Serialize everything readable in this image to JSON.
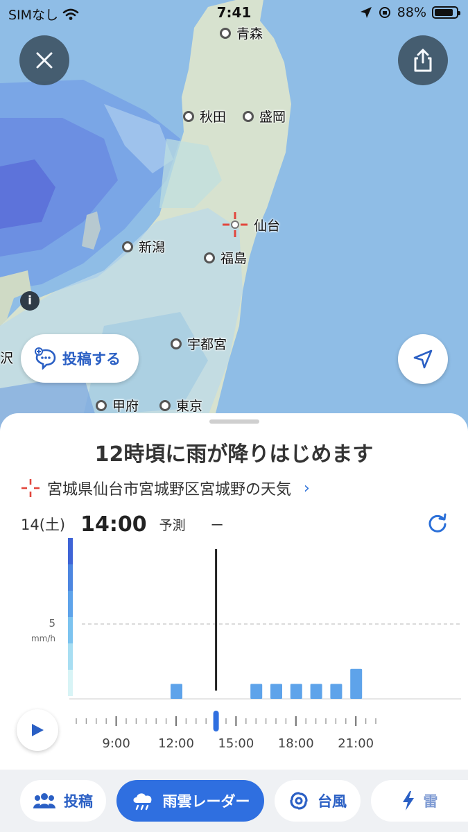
{
  "status_bar": {
    "carrier": "SIMなし",
    "time": "7:41",
    "battery": "88%",
    "battery_level": 0.88
  },
  "map": {
    "cities": [
      {
        "name": "青森"
      },
      {
        "name": "秋田"
      },
      {
        "name": "盛岡"
      },
      {
        "name": "仙台"
      },
      {
        "name": "新潟"
      },
      {
        "name": "福島"
      },
      {
        "name": "宇都宮"
      },
      {
        "name": "甲府"
      },
      {
        "name": "東京"
      }
    ],
    "edge_label": "沢",
    "post_button_label": "投稿する"
  },
  "sheet": {
    "headline": "12時頃に雨が降りはじめます",
    "location": "宮城県仙台市宮城野区宮城野の天気",
    "date": "14(土)",
    "time": "14:00",
    "kind": "予測",
    "value": "ー"
  },
  "chart_data": {
    "type": "bar",
    "ylabel_value": "5",
    "ylabel_unit": "mm/h",
    "current_slot": 14.0,
    "x_ticks": [
      "9:00",
      "12:00",
      "15:00",
      "18:00",
      "21:00"
    ],
    "x_tick_hours": [
      9,
      12,
      15,
      18,
      21
    ],
    "bars": [
      {
        "hour": 12.0,
        "value": 1
      },
      {
        "hour": 16.0,
        "value": 1
      },
      {
        "hour": 17.0,
        "value": 1
      },
      {
        "hour": 18.0,
        "value": 1
      },
      {
        "hour": 19.0,
        "value": 1
      },
      {
        "hour": 20.0,
        "value": 1
      },
      {
        "hour": 21.0,
        "value": 2
      }
    ],
    "y_max": 10
  },
  "tabs": [
    {
      "label": "投稿",
      "active": false
    },
    {
      "label": "雨雲レーダー",
      "active": true
    },
    {
      "label": "台風",
      "active": false
    },
    {
      "label": "雷",
      "active": false
    }
  ],
  "colors": {
    "accent": "#2f6fe0",
    "bar": "#5ea3ea",
    "map_sea": "#8fbde6",
    "map_land": "#d7e2cf"
  }
}
